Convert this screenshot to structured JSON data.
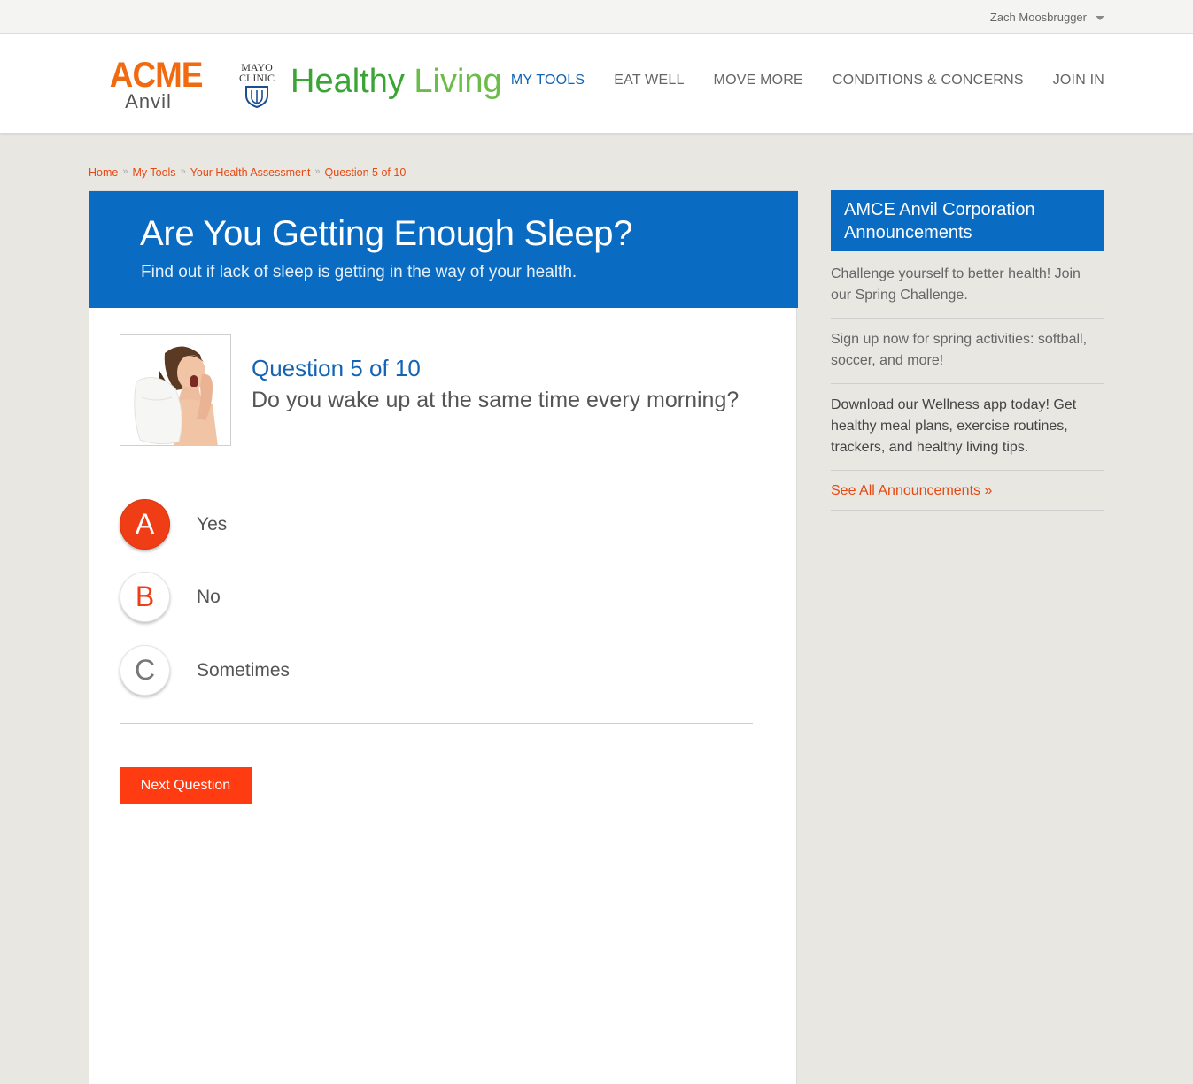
{
  "user": {
    "name": "Zach Moosbrugger"
  },
  "brand": {
    "acme_word": "ACME",
    "anvil_word": "Anvil",
    "mayo_line1": "MAYO",
    "mayo_line2": "CLINIC",
    "title_part1": "Healthy",
    "title_part2": "Living"
  },
  "nav": {
    "items": [
      "MY TOOLS",
      "EAT WELL",
      "MOVE MORE",
      "CONDITIONS & CONCERNS",
      "JOIN IN"
    ],
    "active": "MY TOOLS"
  },
  "breadcrumb": [
    "Home",
    "My Tools",
    "Your Health Assessment",
    "Question 5 of 10"
  ],
  "breadcrumb_sep": "»",
  "hero": {
    "title": "Are You Getting Enough Sleep?",
    "subtitle": "Find out if lack of sleep is getting in the way of your health."
  },
  "question": {
    "label": "Question 5 of 10",
    "text": "Do you wake up at the same time every morning?"
  },
  "answers": [
    {
      "letter": "A",
      "text": "Yes",
      "selected": true
    },
    {
      "letter": "B",
      "text": "No",
      "selected": false
    },
    {
      "letter": "C",
      "text": "Sometimes",
      "selected": false
    }
  ],
  "next_button": "Next Question",
  "sidebar": {
    "heading": "AMCE Anvil Corporation Announcements",
    "items": [
      "Challenge yourself to better health! Join our Spring Challenge.",
      "Sign up now for spring activities: softball, soccer, and more!",
      "Download our Wellness app today! Get healthy meal plans, exercise routines, trackers, and healthy living tips."
    ],
    "see_all": "See All Announcements »"
  },
  "colors": {
    "accent_blue": "#0a6bc2",
    "accent_red": "#ef3e15",
    "acme_orange": "#f26a10",
    "green": "#3aa535"
  }
}
